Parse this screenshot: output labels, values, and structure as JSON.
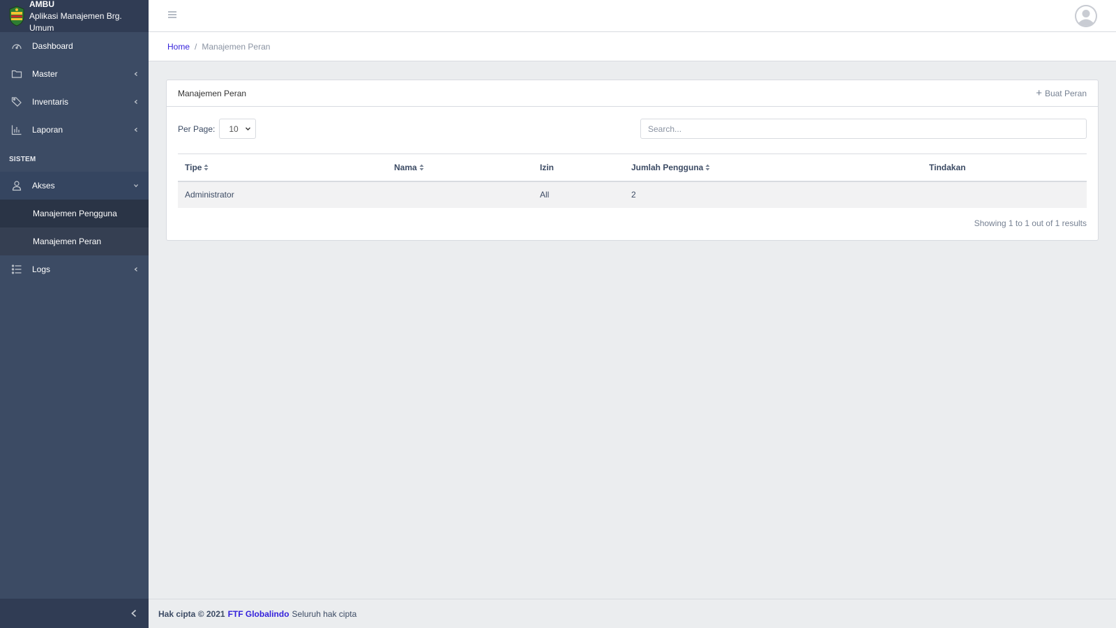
{
  "brand": {
    "title": "AMBU",
    "subtitle": "Aplikasi Manajemen Brg. Umum"
  },
  "sidebar": {
    "items": [
      {
        "label": "Dashboard",
        "icon": "speedometer-icon"
      },
      {
        "label": "Master",
        "icon": "folder-icon"
      },
      {
        "label": "Inventaris",
        "icon": "tags-icon"
      },
      {
        "label": "Laporan",
        "icon": "chart-icon"
      }
    ],
    "section_title": "SISTEM",
    "akses": {
      "label": "Akses",
      "icon": "user-icon"
    },
    "akses_children": [
      "Manajemen Pengguna",
      "Manajemen Peran"
    ],
    "logs": {
      "label": "Logs",
      "icon": "list-icon"
    }
  },
  "breadcrumb": {
    "home": "Home",
    "separator": "/",
    "current": "Manajemen Peran"
  },
  "card": {
    "title": "Manajemen Peran",
    "create_label": "Buat Peran",
    "per_page_label": "Per Page:",
    "per_page_value": "10",
    "search_placeholder": "Search...",
    "columns": [
      "Tipe",
      "Nama",
      "Izin",
      "Jumlah Pengguna",
      "Tindakan"
    ],
    "rows": [
      {
        "tipe": "Administrator",
        "nama": "",
        "izin": "All",
        "jumlah": "2",
        "tindakan": ""
      }
    ],
    "result_text": "Showing 1 to 1 out of 1 results"
  },
  "footer": {
    "copyright": "Hak cipta © 2021",
    "company": "FTF Globalindo",
    "rights": "Seluruh hak cipta"
  },
  "colors": {
    "sidebar": "#3c4b64",
    "link": "#321fdb",
    "background": "#ebedef"
  }
}
